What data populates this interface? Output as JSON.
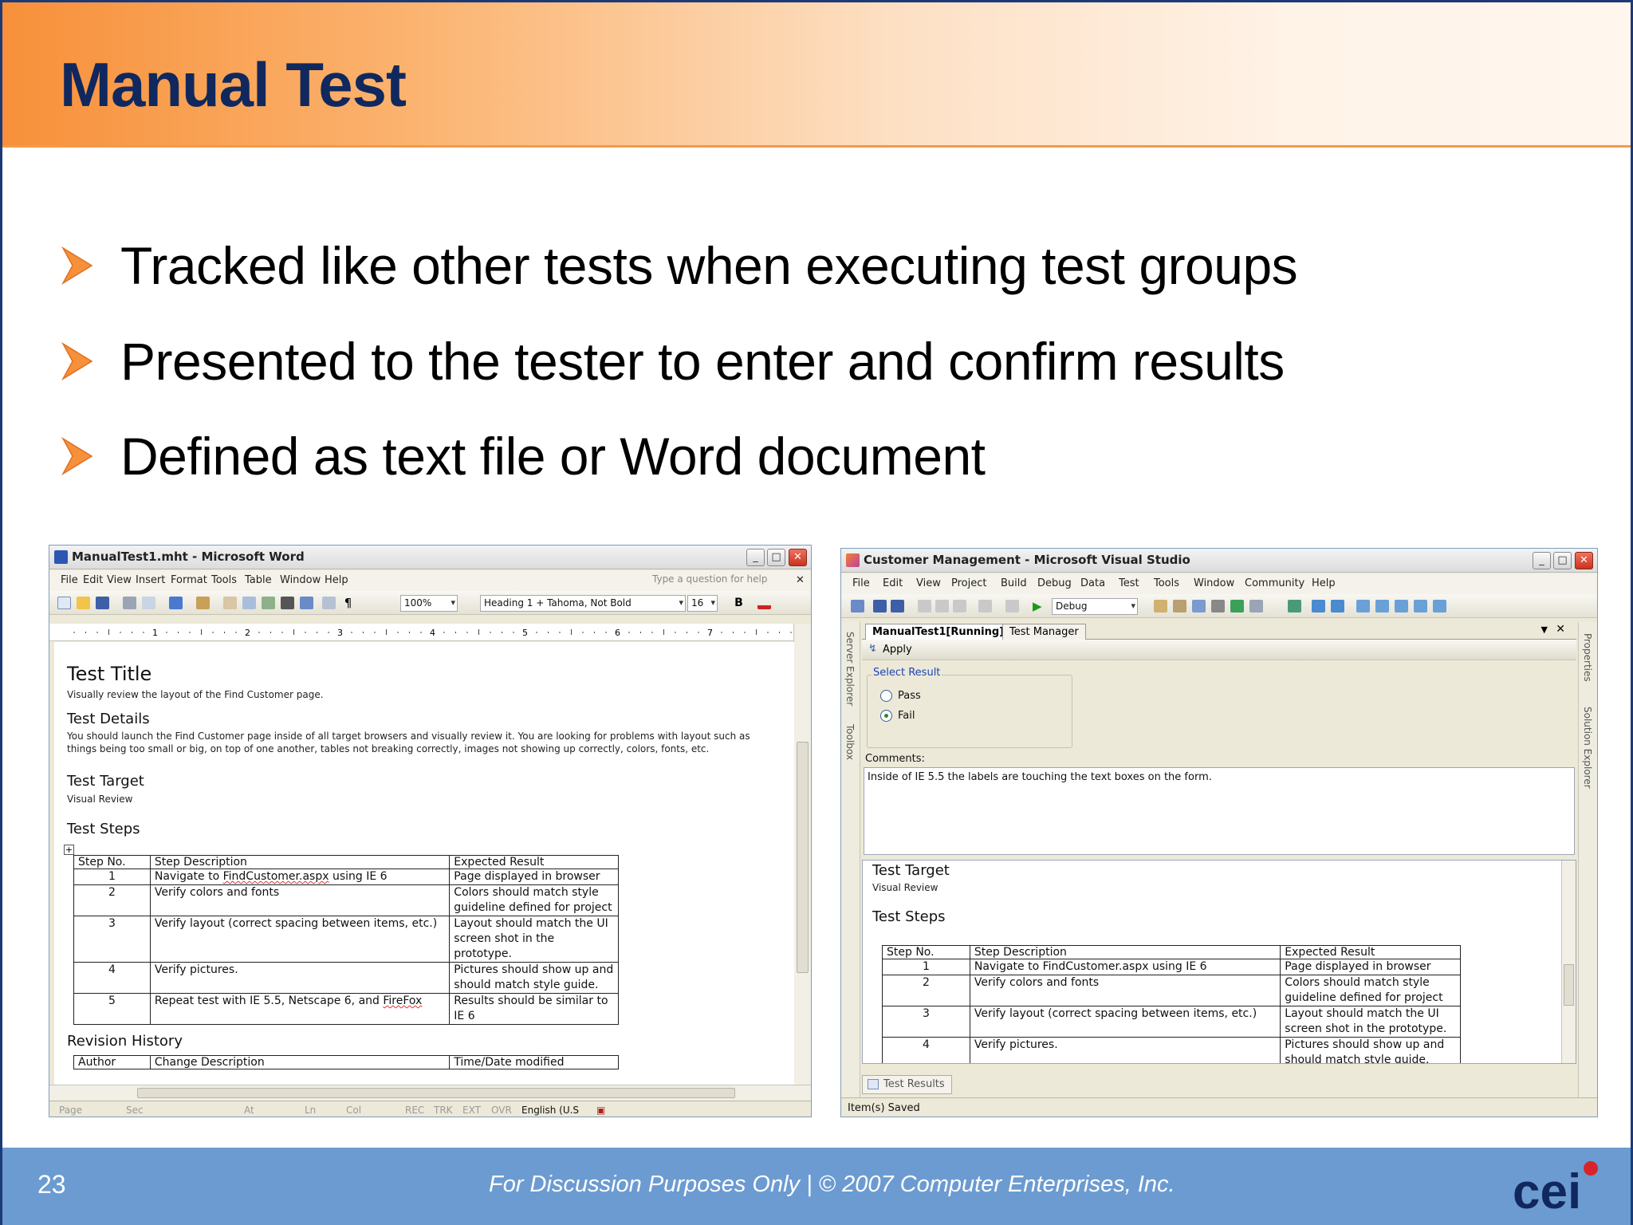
{
  "slide": {
    "title": "Manual Test",
    "bullets": [
      "Tracked like other tests when executing test groups",
      "Presented to the tester to enter and confirm results",
      "Defined as text file or Word document"
    ],
    "page_number": "23",
    "footer": "For Discussion Purposes Only  |  © 2007 Computer Enterprises, Inc.",
    "logo_text": "cei"
  },
  "colors": {
    "navy": "#10285e",
    "orange": "#f7903a",
    "footer_blue": "#6b9bd1"
  },
  "word": {
    "title": "ManualTest1.mht - Microsoft Word",
    "menu": [
      "File",
      "Edit",
      "View",
      "Insert",
      "Format",
      "Tools",
      "Table",
      "Window",
      "Help"
    ],
    "help_placeholder": "Type a question for help",
    "zoom": "100%",
    "style": "Heading 1 + Tahoma, Not Bold",
    "font_size": "16",
    "bold_label": "B",
    "doc": {
      "test_title_heading": "Test Title",
      "test_title_text": "Visually review the layout of the Find Customer page.",
      "test_details_heading": "Test Details",
      "test_details_line1": "You should launch the Find Customer page inside of all target browsers and visually review it. You are looking for problems with layout such as",
      "test_details_line2": "things being too small or big, on top of one another, tables not breaking correctly, images not showing up correctly, colors, fonts, etc.",
      "test_target_heading": "Test Target",
      "test_target_text": "Visual Review",
      "test_steps_heading": "Test Steps",
      "table_headers": [
        "Step No.",
        "Step Description",
        "Expected Result"
      ],
      "rows": [
        {
          "no": "1",
          "desc_pre": "Navigate to ",
          "desc_link": "FindCustomer.aspx",
          "desc_post": " using IE 6",
          "result1": "Page displayed in browser",
          "result2": ""
        },
        {
          "no": "2",
          "desc_pre": "Verify colors and fonts",
          "desc_link": "",
          "desc_post": "",
          "result1": "Colors should match style",
          "result2": "guideline defined for project"
        },
        {
          "no": "3",
          "desc_pre": "Verify layout (correct spacing between items, etc.)",
          "desc_link": "",
          "desc_post": "",
          "result1": "Layout should match the UI",
          "result2": "screen shot in the prototype."
        },
        {
          "no": "4",
          "desc_pre": "Verify pictures.",
          "desc_link": "",
          "desc_post": "",
          "result1": "Pictures should show up and",
          "result2": "should match style guide."
        },
        {
          "no": "5",
          "desc_pre": "Repeat test with IE 5.5, Netscape 6, and ",
          "desc_link": "FireFox",
          "desc_post": "",
          "result1": "Results should be similar to",
          "result2": "IE 6"
        }
      ],
      "revision_heading": "Revision History",
      "revision_headers": [
        "Author",
        "Change Description",
        "Time/Date modified"
      ]
    },
    "status": [
      "Page",
      "Sec",
      "At",
      "Ln",
      "Col",
      "REC",
      "TRK",
      "EXT",
      "OVR",
      "English (U.S"
    ]
  },
  "vs": {
    "title": "Customer Management - Microsoft Visual Studio",
    "menu": [
      "File",
      "Edit",
      "View",
      "Project",
      "Build",
      "Debug",
      "Data",
      "Test",
      "Tools",
      "Window",
      "Community",
      "Help"
    ],
    "config": "Debug",
    "left_strip": [
      "Server Explorer",
      "Toolbox"
    ],
    "right_strip": [
      "Properties",
      "Solution Explorer"
    ],
    "tabs": [
      "ManualTest1[Running]",
      "Test Manager"
    ],
    "apply_label": "Apply",
    "select_result_label": "Select Result",
    "pass_label": "Pass",
    "fail_label": "Fail",
    "selected_result": "Fail",
    "comments_label": "Comments:",
    "comments_value": "Inside of IE 5.5 the labels are touching the text boxes on the form.",
    "preview": {
      "test_target_heading": "Test Target",
      "test_target_text": "Visual Review",
      "test_steps_heading": "Test Steps",
      "table_headers": [
        "Step No.",
        "Step Description",
        "Expected Result"
      ],
      "rows": [
        {
          "no": "1",
          "desc": "Navigate to FindCustomer.aspx using IE 6",
          "result1": "Page displayed in browser",
          "result2": ""
        },
        {
          "no": "2",
          "desc": "Verify colors and fonts",
          "result1": "Colors should match style",
          "result2": "guideline defined for project"
        },
        {
          "no": "3",
          "desc": "Verify layout (correct spacing between items, etc.)",
          "result1": "Layout should match the UI",
          "result2": "screen shot in the prototype."
        },
        {
          "no": "4",
          "desc": "Verify pictures.",
          "result1": "Pictures should show up and",
          "result2": "should match style guide."
        }
      ]
    },
    "bottom_tab": "Test Results",
    "status": "Item(s) Saved"
  }
}
